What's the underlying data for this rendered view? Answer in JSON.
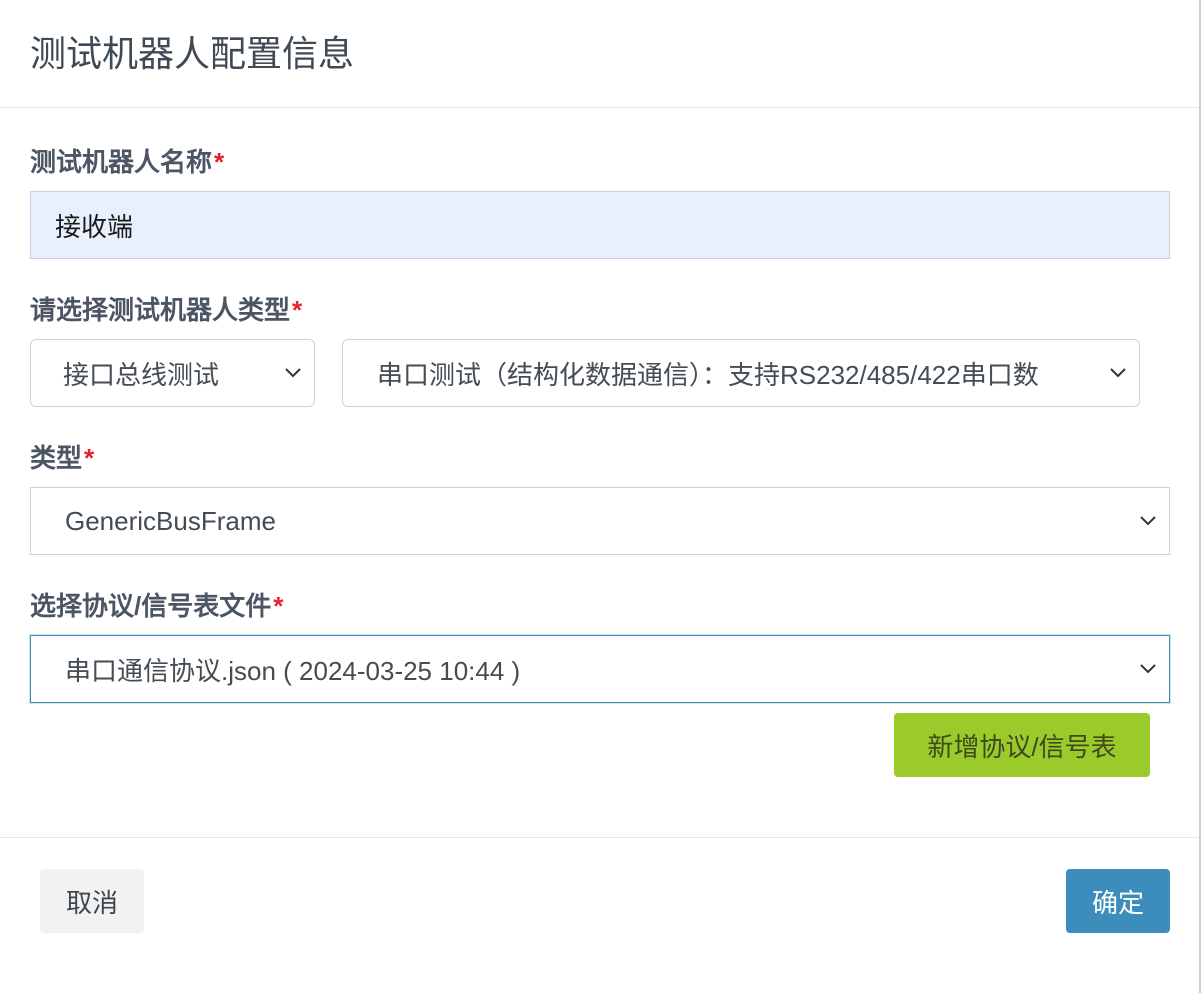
{
  "dialog": {
    "title": "测试机器人配置信息"
  },
  "form": {
    "name": {
      "label": "测试机器人名称",
      "required_mark": "*",
      "value": "接收端"
    },
    "robot_type": {
      "label": "请选择测试机器人类型",
      "required_mark": "*",
      "category_value": "接口总线测试",
      "subtype_value": "串口测试（结构化数据通信）：支持RS232/485/422串口数"
    },
    "type": {
      "label": "类型",
      "required_mark": "*",
      "value": "GenericBusFrame"
    },
    "protocol": {
      "label": "选择协议/信号表文件",
      "required_mark": "*",
      "value": "串口通信协议.json ( 2024-03-25 10:44 )",
      "add_button_label": "新增协议/信号表"
    }
  },
  "footer": {
    "cancel_label": "取消",
    "confirm_label": "确定"
  },
  "colors": {
    "required": "#e5222b",
    "add_button": "#9bcb2a",
    "confirm_button": "#3c8dbc",
    "input_autofill_bg": "#e8f0fe",
    "focus_border": "#3f8fb5"
  },
  "icons": {
    "select_arrow": "chevron-down-icon"
  }
}
